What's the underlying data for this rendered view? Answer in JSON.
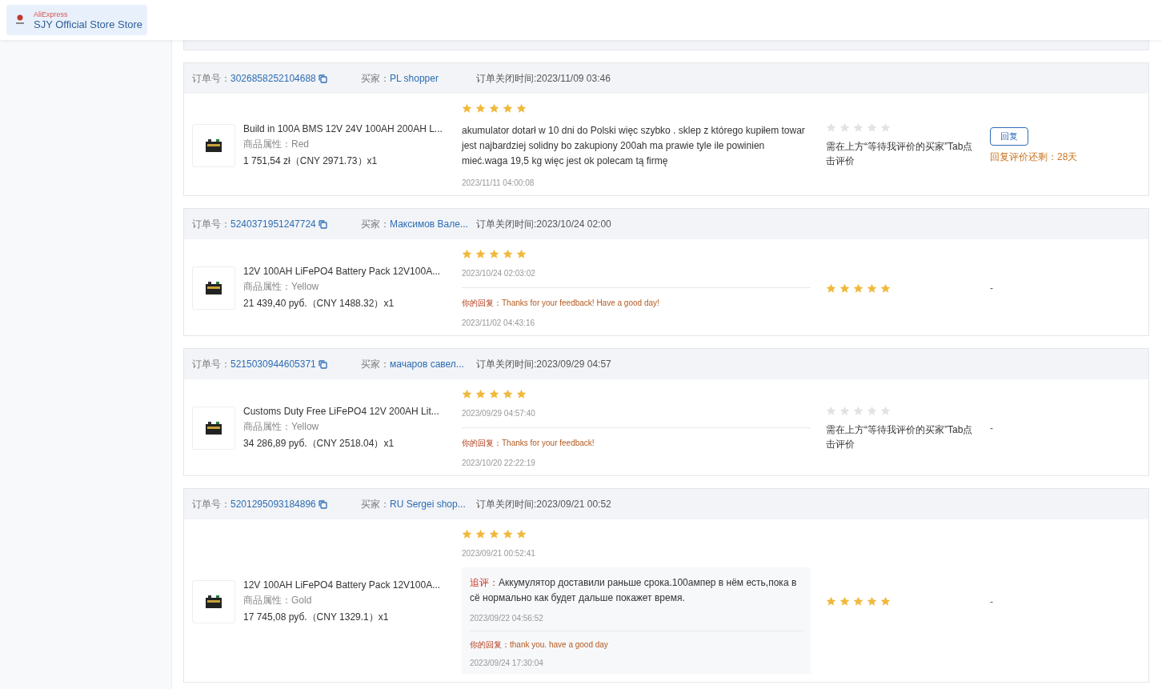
{
  "store": {
    "brand": "AliExpress",
    "name": "SJY Official Store Store"
  },
  "orders": [
    {
      "order_label": "订单号：",
      "order_no": "3026858252104688",
      "buyer_label": "买家：",
      "buyer": "PL shopper",
      "close_time": "订单关闭时间:2023/11/09 03:46",
      "product": {
        "title": "Build in 100A BMS 12V 24V 100AH 200AH L...",
        "attr": "商品属性：Red",
        "price": "1 751,54 zł（CNY  2971.73）x1"
      },
      "review": {
        "stars": 5,
        "text": "akumulator dotarł w 10 dni do Polski więc szybko . sklep z którego kupiłem towar jest najbardziej solidny bo zakupiony 200ah ma prawie tyle ile powinien mieć.waga 19,5 kg więc jest ok polecam tą firmę",
        "time": "2023/11/11 04:00:08"
      },
      "buyer_rating": {
        "stars": 0,
        "note": "需在上方“等待我评价的买家”Tab点击评价"
      },
      "action": {
        "kind": "reply",
        "button": "回复",
        "remaining": "回复评价还剩：28天"
      }
    },
    {
      "order_label": "订单号：",
      "order_no": "5240371951247724",
      "buyer_label": "买家：",
      "buyer": "Максимов Вале...",
      "close_time": "订单关闭时间:2023/10/24 02:00",
      "product": {
        "title": "12V 100AH LiFePO4 Battery Pack 12V100A...",
        "attr": "商品属性：Yellow",
        "price": "21 439,40 руб.（CNY  1488.32）x1"
      },
      "review": {
        "stars": 5,
        "time": "2023/10/24 02:03:02",
        "reply_label": "你的回复：",
        "reply": "Thanks for your feedback! Have a good day!",
        "reply_time": "2023/11/02 04:43:16"
      },
      "buyer_rating": {
        "stars": 5
      },
      "action": {
        "kind": "dash",
        "text": "-"
      }
    },
    {
      "order_label": "订单号：",
      "order_no": "5215030944605371",
      "buyer_label": "买家：",
      "buyer": "мачаров савел...",
      "close_time": "订单关闭时间:2023/09/29 04:57",
      "product": {
        "title": "Customs Duty Free LiFePO4 12V 200AH Lit...",
        "attr": "商品属性：Yellow",
        "price": "34 286,89 руб.（CNY  2518.04）x1"
      },
      "review": {
        "stars": 5,
        "time": "2023/09/29 04:57:40",
        "reply_label": "你的回复：",
        "reply": "Thanks for your feedback!",
        "reply_time": "2023/10/20 22:22:19"
      },
      "buyer_rating": {
        "stars": 0,
        "note": "需在上方“等待我评价的买家”Tab点击评价"
      },
      "action": {
        "kind": "dash",
        "text": "-"
      }
    },
    {
      "order_label": "订单号：",
      "order_no": "5201295093184896",
      "buyer_label": "买家：",
      "buyer": "RU Sergei shop...",
      "close_time": "订单关闭时间:2023/09/21 00:52",
      "product": {
        "title": "12V 100AH LiFePO4 Battery Pack 12V100A...",
        "attr": "商品属性：Gold",
        "price": "17 745,08 руб.（CNY  1329.1）x1"
      },
      "review": {
        "stars": 5,
        "time": "2023/09/21 00:52:41",
        "followup_label": "追评：",
        "followup": "Аккумулятор доставили раньше срока.100ампер в нём есть,пока в сё нормально как будет дальше покажет время.",
        "followup_time": "2023/09/22 04:56:52",
        "reply_label": "你的回复：",
        "reply": "thank you. have a good day",
        "reply_time": "2023/09/24 17:30:04"
      },
      "buyer_rating": {
        "stars": 5
      },
      "action": {
        "kind": "dash",
        "text": "-"
      }
    }
  ]
}
